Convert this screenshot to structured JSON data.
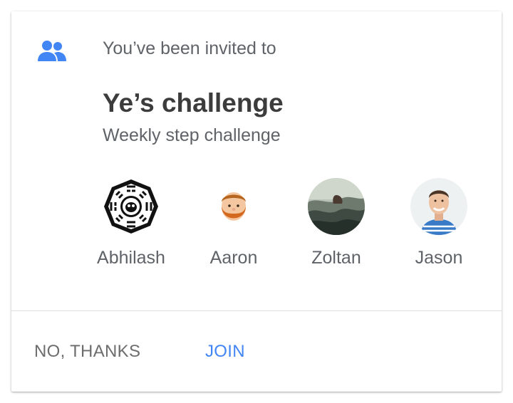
{
  "invite": {
    "header_text": "You’ve been invited to",
    "title": "Ye’s challenge",
    "subtitle": "Weekly step challenge"
  },
  "participants": [
    {
      "name": "Abhilash",
      "avatar": "dharma-logo-avatar"
    },
    {
      "name": "Aaron",
      "avatar": "bearded-cartoon-avatar"
    },
    {
      "name": "Zoltan",
      "avatar": "ocean-wave-photo-avatar"
    },
    {
      "name": "Jason",
      "avatar": "smiling-man-photo-avatar"
    }
  ],
  "actions": {
    "decline_label": "NO, THANKS",
    "join_label": "JOIN"
  },
  "colors": {
    "accent": "#4285f4",
    "title_text": "#3c3c3c",
    "secondary_text": "#5f6368",
    "decline_text": "#6d6d6d"
  },
  "icons": {
    "header_icon": "group-icon"
  }
}
